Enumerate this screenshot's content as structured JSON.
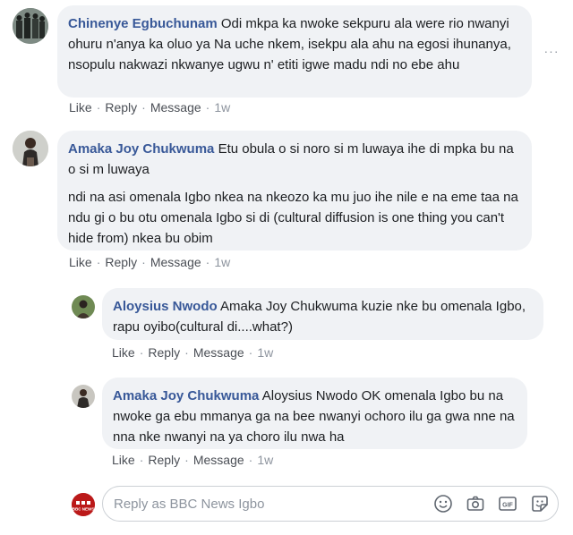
{
  "comments": [
    {
      "author": "Chinenye Egbuchunam",
      "paragraphs": [
        "Odi mkpa ka nwoke sekpuru ala were rio nwanyi ohuru n'anya ka oluo ya Na uche nkem, isekpu ala ahu na egosi ihunanya, nsopulu nakwazi nkwanye ugwu n' etiti igwe madu ndi no ebe ahu"
      ],
      "like_label": "Like",
      "reply_label": "Reply",
      "message_label": "Message",
      "time": "1w"
    },
    {
      "author": "Amaka Joy Chukwuma",
      "paragraphs": [
        "Etu obula o si noro si m luwaya ihe di mpka bu na o si m luwaya",
        "ndi na asi omenala Igbo nkea na nkeozo ka mu juo ihe nile e na eme taa na ndu gi o bu otu omenala Igbo si di (cultural diffusion is one thing you can't hide from) nkea bu obim"
      ],
      "like_label": "Like",
      "reply_label": "Reply",
      "message_label": "Message",
      "time": "1w"
    }
  ],
  "replies": [
    {
      "author": "Aloysius Nwodo",
      "paragraphs": [
        "Amaka Joy Chukwuma kuzie nke bu omenala Igbo, rapu oyibo(cultural di....what?)"
      ],
      "like_label": "Like",
      "reply_label": "Reply",
      "message_label": "Message",
      "time": "1w"
    },
    {
      "author": "Amaka Joy Chukwuma",
      "paragraphs": [
        "Aloysius Nwodo OK omenala Igbo bu na nwoke ga ebu mmanya ga na bee nwanyi ochoro ilu ga gwa nne na nna nke nwanyi na ya choro ilu nwa ha"
      ],
      "like_label": "Like",
      "reply_label": "Reply",
      "message_label": "Message",
      "time": "1w"
    }
  ],
  "more_options": "···",
  "composer": {
    "avatar_brand": "BBC NEWS",
    "placeholder": "Reply as BBC News Igbo",
    "tools": [
      "emoji-icon",
      "camera-icon",
      "gif-icon",
      "sticker-icon"
    ]
  },
  "colors": {
    "author": "#385898",
    "bubble": "#f0f2f5",
    "meta": "#8d949e",
    "bbc_red": "#bb1919"
  }
}
